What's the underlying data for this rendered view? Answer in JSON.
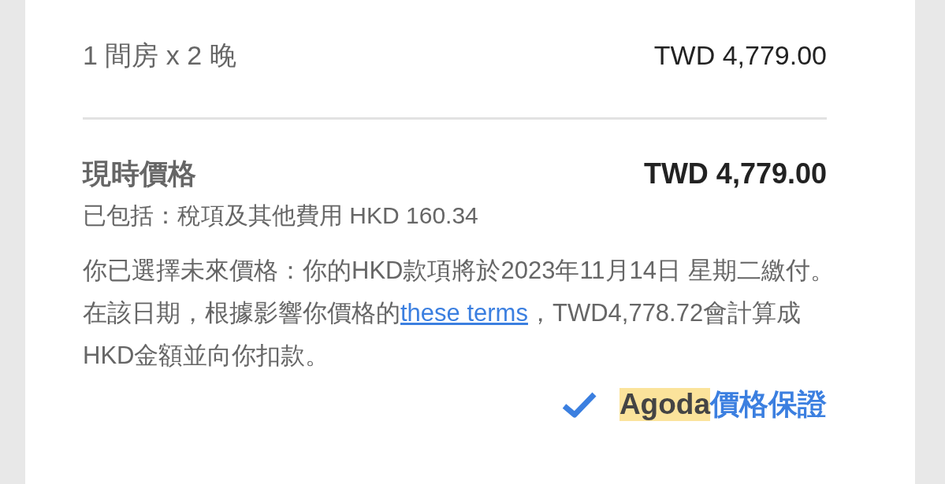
{
  "room_line": {
    "label": "1 間房 x 2 晚",
    "amount": "TWD 4,779.00"
  },
  "current_price": {
    "label": "現時價格",
    "amount": "TWD 4,779.00"
  },
  "taxes_note": "已包括：稅項及其他費用 HKD 160.34",
  "future_price_note": {
    "before": "你已選擇未來價格：你的HKD款項將於2023年11月14日 星期二繳付。在該日期，根據影響你價格的",
    "link": "these terms",
    "after": "，TWD4,778.72會計算成HKD金額並向你扣款。"
  },
  "guarantee": {
    "brand": "Agoda",
    "label": "價格保證"
  }
}
